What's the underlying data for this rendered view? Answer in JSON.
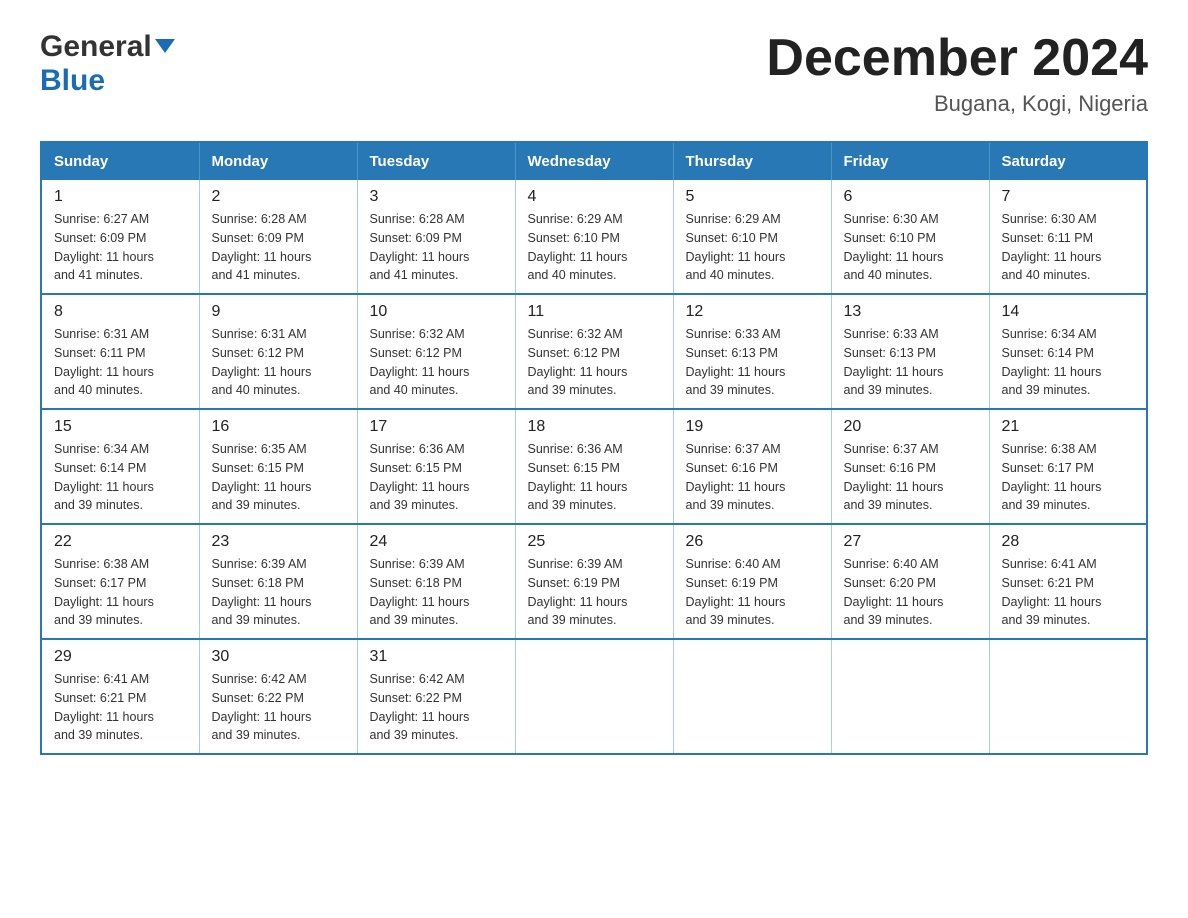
{
  "header": {
    "logo_general": "General",
    "logo_blue": "Blue",
    "title": "December 2024",
    "subtitle": "Bugana, Kogi, Nigeria"
  },
  "days_of_week": [
    "Sunday",
    "Monday",
    "Tuesday",
    "Wednesday",
    "Thursday",
    "Friday",
    "Saturday"
  ],
  "weeks": [
    [
      {
        "day": "1",
        "sunrise": "6:27 AM",
        "sunset": "6:09 PM",
        "daylight": "11 hours and 41 minutes."
      },
      {
        "day": "2",
        "sunrise": "6:28 AM",
        "sunset": "6:09 PM",
        "daylight": "11 hours and 41 minutes."
      },
      {
        "day": "3",
        "sunrise": "6:28 AM",
        "sunset": "6:09 PM",
        "daylight": "11 hours and 41 minutes."
      },
      {
        "day": "4",
        "sunrise": "6:29 AM",
        "sunset": "6:10 PM",
        "daylight": "11 hours and 40 minutes."
      },
      {
        "day": "5",
        "sunrise": "6:29 AM",
        "sunset": "6:10 PM",
        "daylight": "11 hours and 40 minutes."
      },
      {
        "day": "6",
        "sunrise": "6:30 AM",
        "sunset": "6:10 PM",
        "daylight": "11 hours and 40 minutes."
      },
      {
        "day": "7",
        "sunrise": "6:30 AM",
        "sunset": "6:11 PM",
        "daylight": "11 hours and 40 minutes."
      }
    ],
    [
      {
        "day": "8",
        "sunrise": "6:31 AM",
        "sunset": "6:11 PM",
        "daylight": "11 hours and 40 minutes."
      },
      {
        "day": "9",
        "sunrise": "6:31 AM",
        "sunset": "6:12 PM",
        "daylight": "11 hours and 40 minutes."
      },
      {
        "day": "10",
        "sunrise": "6:32 AM",
        "sunset": "6:12 PM",
        "daylight": "11 hours and 40 minutes."
      },
      {
        "day": "11",
        "sunrise": "6:32 AM",
        "sunset": "6:12 PM",
        "daylight": "11 hours and 39 minutes."
      },
      {
        "day": "12",
        "sunrise": "6:33 AM",
        "sunset": "6:13 PM",
        "daylight": "11 hours and 39 minutes."
      },
      {
        "day": "13",
        "sunrise": "6:33 AM",
        "sunset": "6:13 PM",
        "daylight": "11 hours and 39 minutes."
      },
      {
        "day": "14",
        "sunrise": "6:34 AM",
        "sunset": "6:14 PM",
        "daylight": "11 hours and 39 minutes."
      }
    ],
    [
      {
        "day": "15",
        "sunrise": "6:34 AM",
        "sunset": "6:14 PM",
        "daylight": "11 hours and 39 minutes."
      },
      {
        "day": "16",
        "sunrise": "6:35 AM",
        "sunset": "6:15 PM",
        "daylight": "11 hours and 39 minutes."
      },
      {
        "day": "17",
        "sunrise": "6:36 AM",
        "sunset": "6:15 PM",
        "daylight": "11 hours and 39 minutes."
      },
      {
        "day": "18",
        "sunrise": "6:36 AM",
        "sunset": "6:15 PM",
        "daylight": "11 hours and 39 minutes."
      },
      {
        "day": "19",
        "sunrise": "6:37 AM",
        "sunset": "6:16 PM",
        "daylight": "11 hours and 39 minutes."
      },
      {
        "day": "20",
        "sunrise": "6:37 AM",
        "sunset": "6:16 PM",
        "daylight": "11 hours and 39 minutes."
      },
      {
        "day": "21",
        "sunrise": "6:38 AM",
        "sunset": "6:17 PM",
        "daylight": "11 hours and 39 minutes."
      }
    ],
    [
      {
        "day": "22",
        "sunrise": "6:38 AM",
        "sunset": "6:17 PM",
        "daylight": "11 hours and 39 minutes."
      },
      {
        "day": "23",
        "sunrise": "6:39 AM",
        "sunset": "6:18 PM",
        "daylight": "11 hours and 39 minutes."
      },
      {
        "day": "24",
        "sunrise": "6:39 AM",
        "sunset": "6:18 PM",
        "daylight": "11 hours and 39 minutes."
      },
      {
        "day": "25",
        "sunrise": "6:39 AM",
        "sunset": "6:19 PM",
        "daylight": "11 hours and 39 minutes."
      },
      {
        "day": "26",
        "sunrise": "6:40 AM",
        "sunset": "6:19 PM",
        "daylight": "11 hours and 39 minutes."
      },
      {
        "day": "27",
        "sunrise": "6:40 AM",
        "sunset": "6:20 PM",
        "daylight": "11 hours and 39 minutes."
      },
      {
        "day": "28",
        "sunrise": "6:41 AM",
        "sunset": "6:21 PM",
        "daylight": "11 hours and 39 minutes."
      }
    ],
    [
      {
        "day": "29",
        "sunrise": "6:41 AM",
        "sunset": "6:21 PM",
        "daylight": "11 hours and 39 minutes."
      },
      {
        "day": "30",
        "sunrise": "6:42 AM",
        "sunset": "6:22 PM",
        "daylight": "11 hours and 39 minutes."
      },
      {
        "day": "31",
        "sunrise": "6:42 AM",
        "sunset": "6:22 PM",
        "daylight": "11 hours and 39 minutes."
      },
      null,
      null,
      null,
      null
    ]
  ],
  "labels": {
    "sunrise": "Sunrise:",
    "sunset": "Sunset:",
    "daylight": "Daylight:"
  }
}
